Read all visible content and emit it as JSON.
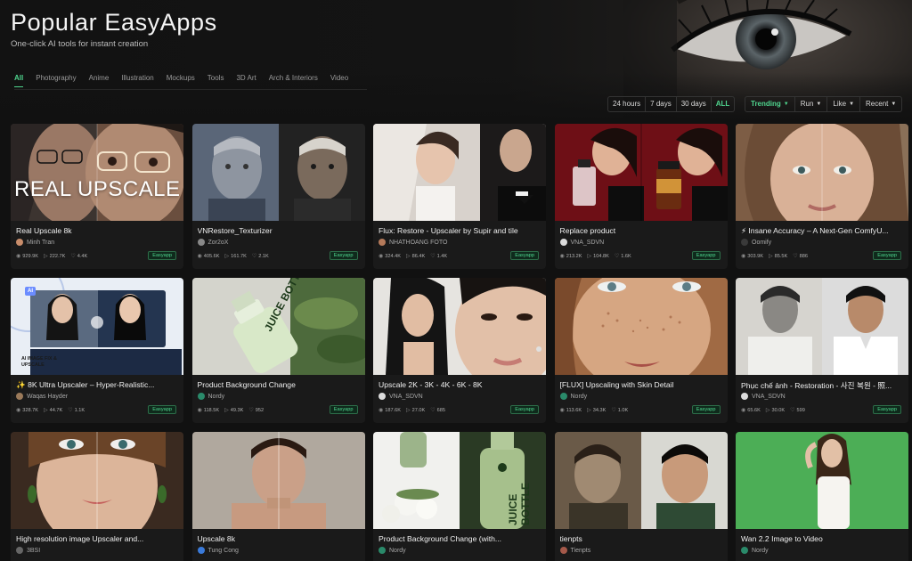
{
  "header": {
    "title": "Popular EasyApps",
    "subtitle": "One-click AI tools for instant creation"
  },
  "categories": [
    "All",
    "Photography",
    "Anime",
    "Illustration",
    "Mockups",
    "Tools",
    "3D Art",
    "Arch & Interiors",
    "Video"
  ],
  "active_category": "All",
  "time_filters": [
    "24 hours",
    "7 days",
    "30 days",
    "ALL"
  ],
  "active_time_filter": "ALL",
  "sort_filters": [
    "Trending",
    "Run",
    "Like",
    "Recent"
  ],
  "active_sort": "Trending",
  "colors": {
    "accent": "#4fd58e",
    "background": "#111111",
    "card": "#1a1a1a"
  },
  "cards": [
    {
      "title": "Real Upscale 8k",
      "author": "Minh Tran",
      "views": "929.9K",
      "runs": "222.7K",
      "likes": "4.4K",
      "badge": "Easyapp",
      "thumb_text": "REAL UPSCALE"
    },
    {
      "title": "VNRestore_Texturizer",
      "author": "Zor2oX",
      "views": "405.6K",
      "runs": "161.7K",
      "likes": "2.1K",
      "badge": "Easyapp"
    },
    {
      "title": "Flux: Restore - Upscaler by Supir and tile",
      "author": "NHATHOANG FOTO",
      "views": "324.4K",
      "runs": "86.4K",
      "likes": "1.4K",
      "badge": "Easyapp"
    },
    {
      "title": "Replace product",
      "author": "VNA_SDVN",
      "views": "213.2K",
      "runs": "104.8K",
      "likes": "1.6K",
      "badge": "Easyapp"
    },
    {
      "title": "⚡ Insane Accuracy – A Next-Gen ComfyU...",
      "author": "Oomify",
      "views": "303.9K",
      "runs": "85.5K",
      "likes": "886",
      "badge": "Easyapp"
    },
    {
      "title": "✨ 8K Ultra Upscaler – Hyper-Realistic...",
      "author": "Waqas Hayder",
      "views": "328.7K",
      "runs": "44.7K",
      "likes": "1.1K",
      "badge": "Easyapp",
      "thumb_text": "AI IMAGE FIX & UPSCALE"
    },
    {
      "title": "Product Background Change",
      "author": "Nordy",
      "views": "118.5K",
      "runs": "49.3K",
      "likes": "952",
      "badge": "Easyapp",
      "thumb_text": "JUICE BOTTLE"
    },
    {
      "title": "Upscale 2K - 3K - 4K - 6K - 8K",
      "author": "VNA_SDVN",
      "views": "187.6K",
      "runs": "27.0K",
      "likes": "685",
      "badge": "Easyapp"
    },
    {
      "title": "[FLUX] Upscaling with Skin Detail",
      "author": "Nordy",
      "views": "113.6K",
      "runs": "34.3K",
      "likes": "1.0K",
      "badge": "Easyapp"
    },
    {
      "title": "Phục chế ảnh - Restoration - 사진 복원 - 照...",
      "author": "VNA_SDVN",
      "views": "65.6K",
      "runs": "30.0K",
      "likes": "599",
      "badge": "Easyapp"
    },
    {
      "title": "High resolution image Upscaler and...",
      "author": "3BSI",
      "views": "",
      "runs": "",
      "likes": "",
      "badge": ""
    },
    {
      "title": "Upscale 8k",
      "author": "Tung Cong",
      "views": "",
      "runs": "",
      "likes": "",
      "badge": ""
    },
    {
      "title": "Product Background Change (with...",
      "author": "Nordy",
      "views": "",
      "runs": "",
      "likes": "",
      "badge": "",
      "thumb_text": "JUICE BOTTLE"
    },
    {
      "title": "tienpts",
      "author": "Tienpts",
      "views": "",
      "runs": "",
      "likes": "",
      "badge": ""
    },
    {
      "title": "Wan 2.2 Image to Video",
      "author": "Nordy",
      "views": "",
      "runs": "",
      "likes": "",
      "badge": ""
    }
  ]
}
